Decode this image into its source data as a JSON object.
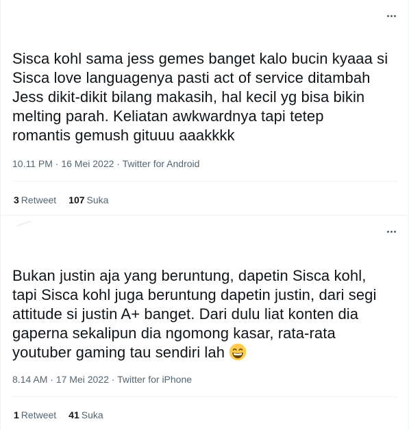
{
  "tweets": [
    {
      "text": "Sisca kohl sama jess gemes banget kalo bucin kyaaa si\nSisca love languagenya pasti act of service ditambah\nJess dikit-dikit bilang makasih, hal kecil yg bisa bikin\nmelting parah. Keliatan awkwardnya tapi tetep\nromantis gemush gituuu aaakkkk",
      "time": "10.11 PM",
      "date": "16 Mei 2022",
      "source": "Twitter for Android",
      "retweets": "3",
      "retweet_label": "Retweet",
      "likes": "107",
      "like_label": "Suka"
    },
    {
      "text": "Bukan justin aja yang beruntung, dapetin Sisca kohl,\ntapi Sisca kohl juga beruntung dapetin justin, dari segi\nattitude si justin A+ banget. Dari dulu liat konten dia\ngaperna sekalipun dia ngomong kasar, rata-rata\nyoutuber gaming tau sendiri lah",
      "emoji": "grinning-face-with-smiling-eyes",
      "time": "8.14 AM",
      "date": "17 Mei 2022",
      "source": "Twitter for iPhone",
      "retweets": "1",
      "retweet_label": "Retweet",
      "likes": "41",
      "like_label": "Suka"
    }
  ],
  "separator": "·",
  "icons": {
    "more": "more-horizontal-icon"
  },
  "colors": {
    "text": "#0f1419",
    "secondary": "#536471",
    "border": "#eff3f4"
  }
}
